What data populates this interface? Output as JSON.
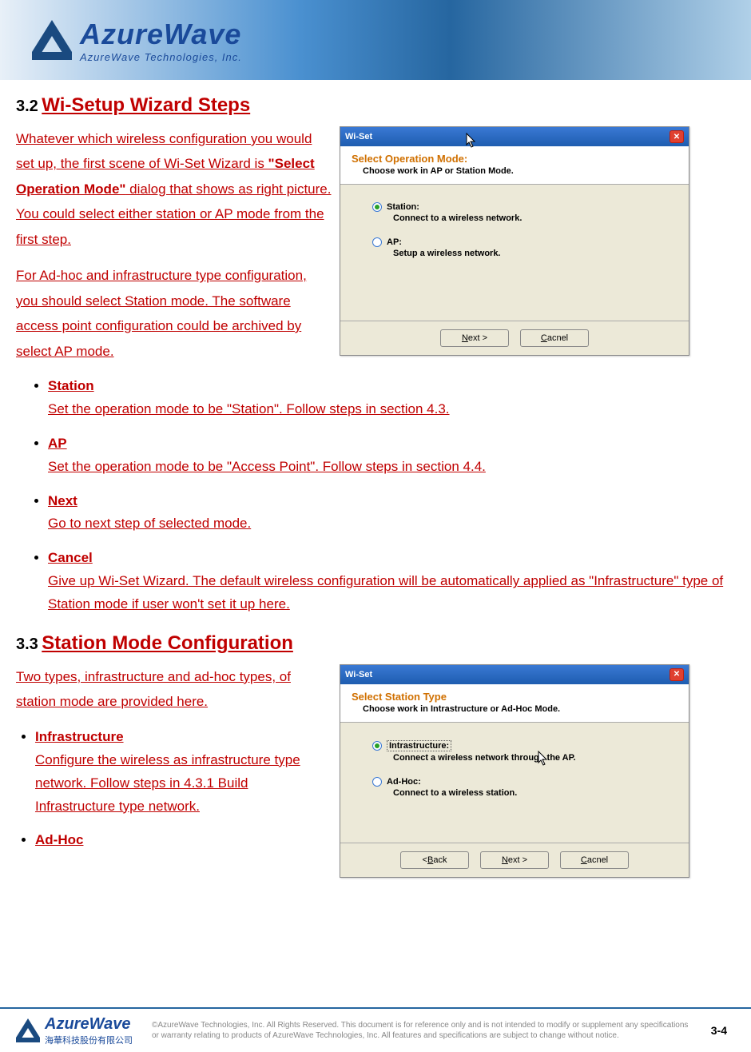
{
  "header": {
    "brand": "AzureWave",
    "tagline": "AzureWave  Technologies,  Inc."
  },
  "section32": {
    "num": "3.2",
    "title": "Wi-Setup Wizard Steps",
    "para1_a": "Whatever which wireless configuration you would set up, the first scene of Wi-Set Wizard is ",
    "para1_bold": "\"Select Operation Mode\"",
    "para1_b": " dialog that shows as right picture. You could select either station or AP mode from the first step.",
    "para2": "For Ad-hoc and infrastructure type configuration, you should select Station mode. The software access point configuration could be archived by select AP mode.",
    "bullets": [
      {
        "head": "Station",
        "desc": "Set the operation mode to be \"Station\". Follow steps in section 4.3."
      },
      {
        "head": "AP",
        "desc": "Set the operation mode to be \"Access Point\". Follow steps in section 4.4."
      },
      {
        "head": "Next",
        "desc": "Go to next step of selected mode."
      },
      {
        "head": "Cancel",
        "desc": "Give up Wi-Set Wizard. The default wireless configuration will be automatically applied as \"Infrastructure\" type of Station mode if user won't set it up here."
      }
    ]
  },
  "dialog1": {
    "title": "Wi-Set",
    "head1": "Select Operation Mode:",
    "head2": "Choose work in AP or Station Mode.",
    "opt1_label": "Station:",
    "opt1_desc": "Connect to a wireless network.",
    "opt2_label": "AP:",
    "opt2_desc": "Setup a wireless network.",
    "next": "Next >",
    "cancel": "Cacnel"
  },
  "section33": {
    "num": "3.3",
    "title": "Station Mode Configuration",
    "para1": "Two types, infrastructure and ad-hoc types, of station mode are provided here.",
    "bullets": [
      {
        "head": "Infrastructure",
        "desc": "Configure the wireless as infrastructure type network. Follow steps in 4.3.1 Build Infrastructure type network."
      },
      {
        "head": "Ad-Hoc",
        "desc": ""
      }
    ]
  },
  "dialog2": {
    "title": "Wi-Set",
    "head1": "Select Station Type",
    "head2": "Choose work in Intrastructure or Ad-Hoc Mode.",
    "opt1_label": "Intrastructure:",
    "opt1_desc": "Connect a wireless network through the AP.",
    "opt2_label": "Ad-Hoc:",
    "opt2_desc": "Connect to a wireless station.",
    "back": "< Back",
    "next": "Next >",
    "cancel": "Cacnel"
  },
  "footer": {
    "brand": "AzureWave",
    "brand_cn": "海華科技股份有限公司",
    "disclaimer": "©AzureWave Technologies, Inc. All Rights Reserved. This document is for reference only and is not intended to modify or supplement any specifications or warranty relating to products of AzureWave Technologies, Inc. All features and specifications are subject to change without notice.",
    "pagenum": "3-4"
  }
}
